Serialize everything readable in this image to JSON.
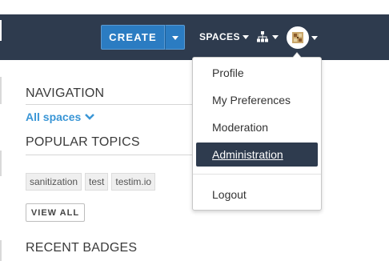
{
  "colors": {
    "topbar": "#2e3b4e",
    "primary_button": "#2b7cc2",
    "link": "#3a96d6",
    "menu_active": "#2e3b4e"
  },
  "header": {
    "create_label": "CREATE",
    "spaces_label": "SPACES",
    "icons": [
      "chevron-down-icon",
      "sitemap-icon",
      "user-avatar-icon"
    ]
  },
  "sidebar": {
    "navigation_title": "NAVIGATION",
    "all_spaces_label": "All spaces",
    "popular_topics_title": "POPULAR TOPICS",
    "topics": [
      "sanitization",
      "test",
      "testim.io"
    ],
    "view_all_label": "VIEW ALL",
    "recent_badges_title": "RECENT BADGES"
  },
  "user_menu": {
    "items": [
      {
        "label": "Profile"
      },
      {
        "label": "My Preferences"
      },
      {
        "label": "Moderation"
      },
      {
        "label": "Administration",
        "active": true
      },
      {
        "label": "Logout"
      }
    ]
  }
}
